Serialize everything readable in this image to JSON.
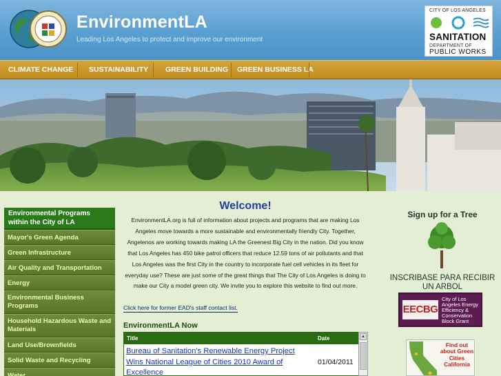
{
  "header": {
    "site_title": "EnvironmentLA",
    "tagline": "Leading Los Angeles to protect and improve our environment",
    "sanitation": {
      "city": "CITY OF LOS ANGELES",
      "title": "SANITATION",
      "dept": "DEPARTMENT OF",
      "public_works": "PUBLIC WORKS"
    }
  },
  "nav": {
    "items": [
      "CLIMATE CHANGE",
      "SUSTAINABILITY",
      "GREEN BUILDING",
      "GREEN BUSINESS LA"
    ]
  },
  "sidebar": {
    "header": "Environmental Programs within the City of LA",
    "items": [
      "Mayor's Green Agenda",
      "Green Infrastructure",
      "Air Quality and Transportation",
      "Energy",
      "Environmental Business Programs",
      "Household Hazardous Waste and Materials",
      "Land Use/Brownfields",
      "Solid Waste and Recycling",
      "Water"
    ]
  },
  "main": {
    "welcome": "Welcome!",
    "intro": "EnvironmentLA.org is full of information about projects and programs that are making Los Angeles move towards a more sustainable and environmentally friendly City. Together, Angelenos are working towards making LA the Greenest Big City in the nation. Did you know that Los Angeles has 450 bike patrol officers that reduce 12.59 tons of air pollutants and that Los Angeles was the first City in the country to incorporate fuel cell vehicles in its fleet for everyday use? These are just some of the great things that The City of Los Angeles is doing to make our City a model green city. We invite you to explore this website to find out more.",
    "contact_link": "Click here for former EAD's staff contact list.",
    "now_title": "EnvironmentLA Now",
    "now_table": {
      "col_title": "Title",
      "col_date": "Date",
      "rows": [
        {
          "title": "Bureau of Sanitation's Renewable Energy Project Wins National League of Cities 2010 Award of Excellence",
          "date": "01/04/2011"
        }
      ]
    }
  },
  "right": {
    "signup": "Sign up for a Tree",
    "inscribase": "INSCRIBASE PARA RECIBIR UN ARBOL",
    "eecbg_abbr": "EECBG",
    "eecbg_text": "City of Los Angeles Energy Efficiency & Conservation Block Grant",
    "green_cities": "Find out about Green Cities California"
  },
  "colors": {
    "header_blue": "#5a9fd1",
    "nav_gold": "#c9971f",
    "sidebar_green": "#5f7b2d",
    "welcome_blue": "#1f3f9f",
    "eecbg_purple": "#5e1d52"
  }
}
